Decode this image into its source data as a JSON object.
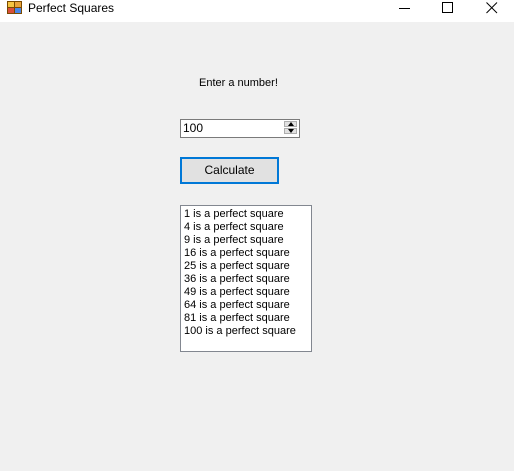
{
  "window": {
    "title": "Perfect Squares",
    "icon": "winforms-app-icon",
    "controls": [
      "minimize-icon",
      "maximize-icon",
      "close-icon"
    ]
  },
  "form": {
    "prompt_label": "Enter a number!",
    "number_input": {
      "value": "100"
    },
    "calculate_button_label": "Calculate",
    "results": [
      "1 is a perfect square",
      "4 is a perfect square",
      "9 is a perfect square",
      "16 is a perfect square",
      "25 is a perfect square",
      "36 is a perfect square",
      "49 is a perfect square",
      "64 is a perfect square",
      "81 is a perfect square",
      "100 is a perfect square"
    ]
  },
  "colors": {
    "window_background": "#f0f0f0",
    "titlebar_background": "#ffffff",
    "button_focus_border": "#0078d7",
    "button_background": "#e1e1e1"
  }
}
